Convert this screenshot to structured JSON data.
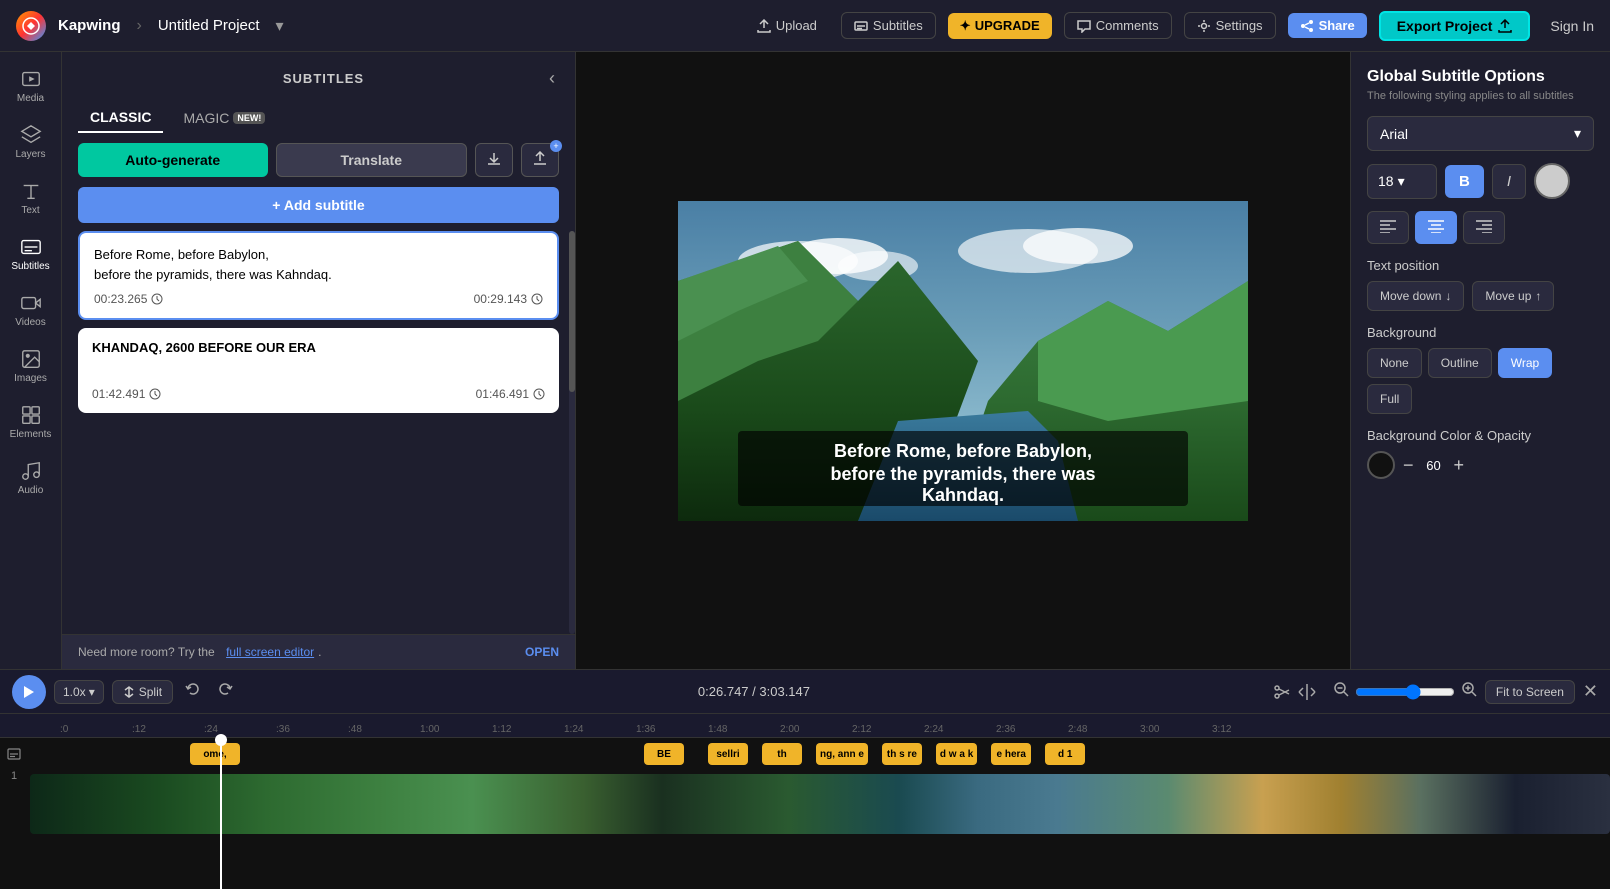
{
  "app": {
    "logo_label": "K",
    "brand": "Kapwing",
    "project_name": "Untitled Project",
    "sign_in": "Sign In"
  },
  "topnav": {
    "upload": "Upload",
    "subtitles": "Subtitles",
    "upgrade": "UPGRADE",
    "upgrade_icon": "✦",
    "comments": "Comments",
    "settings": "Settings",
    "share": "Share",
    "export": "Export Project"
  },
  "icon_sidebar": {
    "items": [
      {
        "id": "media",
        "label": "Media",
        "icon": "media"
      },
      {
        "id": "layers",
        "label": "Layers",
        "icon": "layers"
      },
      {
        "id": "text",
        "label": "Text",
        "icon": "text"
      },
      {
        "id": "subtitles",
        "label": "Subtitles",
        "icon": "subtitles"
      },
      {
        "id": "videos",
        "label": "Videos",
        "icon": "videos"
      },
      {
        "id": "images",
        "label": "Images",
        "icon": "images"
      },
      {
        "id": "elements",
        "label": "Elements",
        "icon": "elements"
      },
      {
        "id": "audio",
        "label": "Audio",
        "icon": "audio"
      }
    ]
  },
  "subtitle_panel": {
    "title": "SUBTITLES",
    "tab_classic": "CLASSIC",
    "tab_magic": "MAGIC",
    "badge_new": "NEW!",
    "btn_autogenerate": "Auto-generate",
    "btn_translate": "Translate",
    "btn_add_subtitle": "+ Add subtitle",
    "subtitles": [
      {
        "id": 1,
        "text": "Before Rome, before Babylon,\nbefore the pyramids, there was Kahndaq.",
        "start": "00:23.265",
        "end": "00:29.143",
        "active": true
      },
      {
        "id": 2,
        "text": "KHANDAQ, 2600 BEFORE OUR ERA",
        "start": "01:42.491",
        "end": "01:46.491",
        "active": false
      }
    ],
    "footer_text": "Need more room? Try the",
    "footer_link": "full screen editor",
    "footer_dot": ".",
    "open_btn": "OPEN"
  },
  "video": {
    "subtitle_line1": "Before Rome, before Babylon,",
    "subtitle_line2": "before the pyramids, there was",
    "subtitle_line3": "Kahndaq."
  },
  "right_panel": {
    "title": "Global Subtitle Options",
    "subtitle_text": "The following styling applies to all subtitles",
    "font": "Arial",
    "font_size": "18",
    "bold_label": "B",
    "italic_label": "I",
    "align_left": "≡",
    "align_center": "≡",
    "align_right": "≡",
    "text_position_label": "Text position",
    "move_down": "Move down",
    "move_down_icon": "↓",
    "move_up": "Move up",
    "move_up_icon": "↑",
    "background_label": "Background",
    "bg_none": "None",
    "bg_outline": "Outline",
    "bg_wrap": "Wrap",
    "bg_full": "Full",
    "bg_color_label": "Background Color & Opacity",
    "opacity_value": "60",
    "opacity_minus": "−",
    "opacity_plus": "+"
  },
  "timeline": {
    "current_time": "0:26.747",
    "total_time": "3:03.147",
    "speed": "1.0x",
    "split_label": "Split",
    "fit_label": "Fit to Screen",
    "ruler_ticks": [
      ":0",
      ":12",
      ":24",
      ":36",
      ":48",
      "1:00",
      "1:12",
      "1:24",
      "1:36",
      "1:48",
      "2:00",
      "2:12",
      "2:24",
      "2:36",
      "2:48",
      "3:00",
      "3:12"
    ],
    "subtitle_clips": [
      "ome,",
      "BE",
      "sellri",
      "th",
      "ng, ann e",
      "th s re",
      "d w a k",
      "e hera",
      "d 1"
    ],
    "track_number": "1"
  }
}
